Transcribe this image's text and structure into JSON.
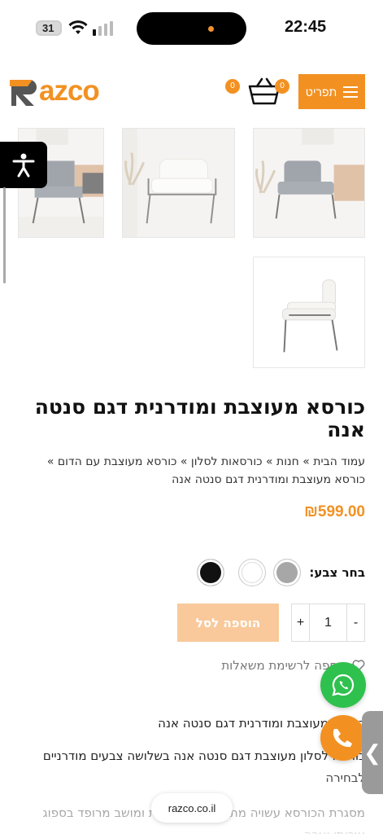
{
  "status_bar": {
    "time": "22:45",
    "battery": "31"
  },
  "header": {
    "logo_text": "azco",
    "logo_letter": "R",
    "menu_label": "תפריט",
    "wishlist_count": "0",
    "cart_count": "0",
    "icons": [
      "menu-icon",
      "cart-icon"
    ]
  },
  "gallery": {
    "thumbnails": [
      "chair-gray",
      "chair-white",
      "chair-lifestyle",
      "chair-side"
    ]
  },
  "product": {
    "title": "כורסא מעוצבת ומודרנית דגם סנטה אנה",
    "breadcrumbs": "עמוד הבית » חנות » כורסאות לסלון » כורסא מעוצבת עם הדום » כורסא מעוצבת ומודרנית דגם סנטה אנה",
    "price": "₪599.00",
    "color_label": "בחר צבע:",
    "colors": [
      "#a7a7a7",
      "#ffffff",
      "#111111"
    ],
    "quantity": "1",
    "plus": "+",
    "minus": "-",
    "add_to_cart": "הוספה לסל",
    "wishlist": "הוספה לרשימת משאלות",
    "desc_title": "כורסא מעוצבת ומודרנית דגם סנטה אנה",
    "desc_p1": "כורסא לסלון מעוצבת דגם סנטה אנה בשלושה צבעים מודרניים לבחירה",
    "desc_p2": "מסגרת הכורסא עשויה מתכת בשילוב ידיות ומושב מרופד בספוג איכותי ועבה"
  },
  "browser": {
    "url": "razco.co.il"
  },
  "colors": {
    "accent": "#f29122",
    "whatsapp": "#2fc14e",
    "add_to_cart_disabled": "#f9c99b"
  }
}
